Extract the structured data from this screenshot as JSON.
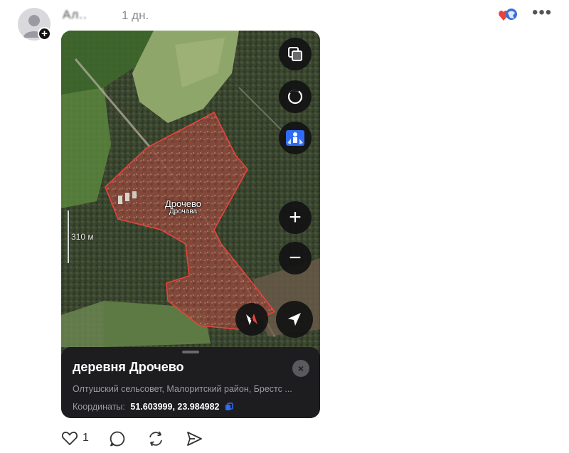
{
  "post": {
    "author": "Ал..",
    "time": "1 дн.",
    "more_label": "•••",
    "avatar_add": "+"
  },
  "map": {
    "place_name": "Дрочево",
    "place_name_alt": "Дрочава",
    "scale": "310 м",
    "buttons": [
      "layers-icon",
      "panorama-icon",
      "street-view-icon",
      "zoom-in",
      "zoom-out",
      "compass",
      "locate-me"
    ],
    "zoom_in_label": "+",
    "zoom_out_label": "−"
  },
  "sheet": {
    "title": "деревня Дрочево",
    "address": "Олтушский сельсовет, Малоритский район, Брестс ...",
    "coords_label": "Координаты:",
    "coords_value": "51.603999, 23.984982",
    "close_label": "×"
  },
  "actions": {
    "like_count": "1"
  },
  "colors": {
    "accent_red": "#e8433c",
    "sheet_bg": "#1d1d20",
    "button_bg": "#121214",
    "copy_blue": "#2f6cf6"
  }
}
